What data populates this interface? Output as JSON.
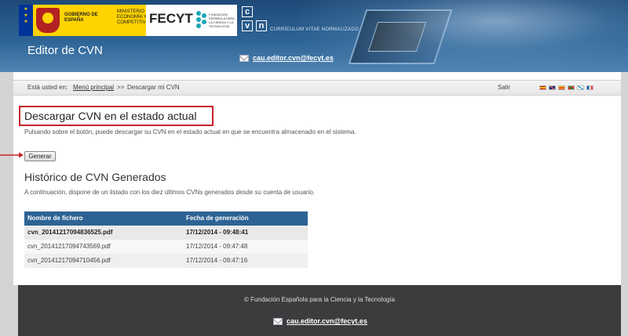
{
  "header": {
    "logos": {
      "gobierno": "GOBIERNO DE ESPAÑA",
      "ministerio": "MINISTERIO DE ECONOMÍA Y COMPETITIVIDAD",
      "fecyt": "FECYT",
      "fecyt_sub": "FUNDACIÓN ESPAÑOLA PARA LA CIENCIA Y LA TECNOLOGÍA",
      "cvn_caption": "CURRÍCULUM VITAE NORMALIZADO"
    },
    "app_title": "Editor de CVN",
    "contact_email": "cau.editor.cvn@fecyt.es"
  },
  "breadcrumb": {
    "prefix": "Está usted en:",
    "link": "Menú principal",
    "separator": ">>",
    "current": "Descargar mi CVN",
    "logout": "Salir"
  },
  "languages": [
    {
      "name": "es-flag-icon",
      "color": "#e8b400"
    },
    {
      "name": "en-flag-icon",
      "color": "#c8102e"
    },
    {
      "name": "ca-flag-icon",
      "color": "#e6b800"
    },
    {
      "name": "eu-flag-icon",
      "color": "#b22222"
    },
    {
      "name": "gl-flag-icon",
      "color": "#6fa8dc"
    },
    {
      "name": "fr-flag-icon",
      "color": "#0055a4"
    }
  ],
  "download": {
    "title": "Descargar CVN en el estado actual",
    "description": "Pulsando sobre el botón, puede descargar su CVN en el estado actual en que se encuentra almacenado en el sistema.",
    "button": "Generar"
  },
  "history": {
    "title": "Histórico de CVN Generados",
    "description": "A continuación, dispone de un listado con los diez últimos CVNs generados desde su cuenta de usuario.",
    "columns": [
      "Nombre de fichero",
      "Fecha de generación"
    ],
    "rows": [
      {
        "file": "cvn_20141217094836525.pdf",
        "date": "17/12/2014 - 09:48:41"
      },
      {
        "file": "cvn_20141217094743569.pdf",
        "date": "17/12/2014 - 09:47:48"
      },
      {
        "file": "cvn_20141217094710456.pdf",
        "date": "17/12/2014 - 09:47:16"
      }
    ]
  },
  "footer": {
    "copyright": "© Fundación Española para la Ciencia y la Tecnología",
    "email": "cau.editor.cvn@fecyt.es"
  },
  "colors": {
    "accent": "#2d6394",
    "highlight_box": "#c8202a",
    "footer_bg": "#3c3c3e"
  }
}
